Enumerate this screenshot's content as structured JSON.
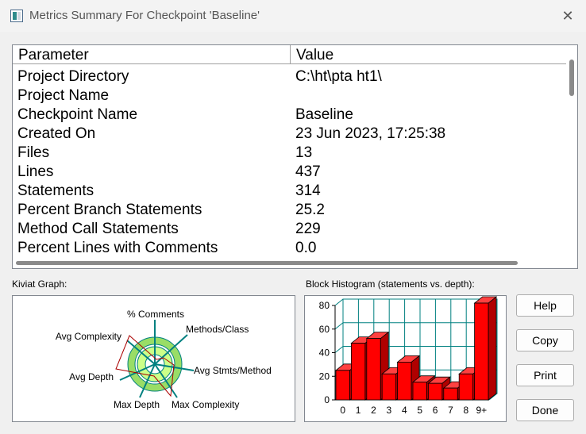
{
  "window": {
    "title": "Metrics Summary For Checkpoint 'Baseline'",
    "close_glyph": "✕"
  },
  "grid": {
    "columns": [
      "Parameter",
      "Value"
    ],
    "rows": [
      {
        "param": "Project Directory",
        "value": "C:\\ht\\pta ht1\\"
      },
      {
        "param": "Project Name",
        "value": ""
      },
      {
        "param": "Checkpoint Name",
        "value": "Baseline"
      },
      {
        "param": "Created On",
        "value": "23 Jun 2023, 17:25:38"
      },
      {
        "param": "Files",
        "value": "13"
      },
      {
        "param": "Lines",
        "value": "437"
      },
      {
        "param": "Statements",
        "value": "314"
      },
      {
        "param": "Percent Branch Statements",
        "value": "25.2"
      },
      {
        "param": "Method Call Statements",
        "value": "229"
      },
      {
        "param": "Percent Lines with Comments",
        "value": "0.0"
      }
    ]
  },
  "kiviat": {
    "label": "Kiviat Graph:",
    "axes": [
      "% Comments",
      "Methods/Class",
      "Avg Stmts/Method",
      "Max Complexity",
      "Max Depth",
      "Avg Depth",
      "Avg Complexity"
    ],
    "colors": {
      "outer_ring": "#99dd66",
      "inner_ring": "#ccff88",
      "axis": "#008080",
      "polygon": "#aa0000"
    }
  },
  "histogram": {
    "label": "Block Histogram (statements vs. depth):"
  },
  "buttons": {
    "help": "Help",
    "copy": "Copy",
    "print": "Print",
    "done": "Done"
  },
  "chart_data": {
    "type": "bar",
    "categories": [
      "0",
      "1",
      "2",
      "3",
      "4",
      "5",
      "6",
      "7",
      "8",
      "9+"
    ],
    "values": [
      25,
      48,
      52,
      22,
      32,
      15,
      14,
      10,
      22,
      82
    ],
    "ylim": [
      0,
      80
    ],
    "yticks": [
      0,
      20,
      40,
      60,
      80
    ],
    "grid": true,
    "bar_color": "#ff0000",
    "grid_color": "#008080"
  }
}
